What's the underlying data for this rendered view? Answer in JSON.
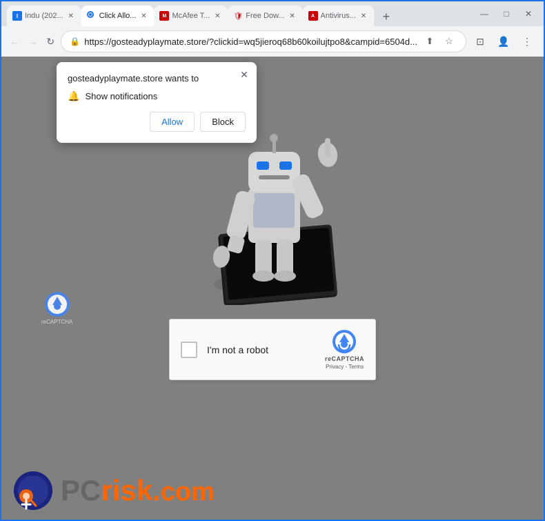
{
  "browser": {
    "tabs": [
      {
        "id": "tab1",
        "title": "Indu (202...",
        "active": false,
        "favicon": "indu"
      },
      {
        "id": "tab2",
        "title": "Click Allo...",
        "active": true,
        "favicon": "click"
      },
      {
        "id": "tab3",
        "title": "McAfee T...",
        "active": false,
        "favicon": "mcafee"
      },
      {
        "id": "tab4",
        "title": "Free Dow...",
        "active": false,
        "favicon": "shield"
      },
      {
        "id": "tab5",
        "title": "Antivirus...",
        "active": false,
        "favicon": "antivirus"
      }
    ],
    "new_tab_label": "+",
    "window_controls": {
      "minimize": "—",
      "maximize": "□",
      "close": "✕"
    },
    "nav": {
      "back": "←",
      "forward": "→",
      "reload": "↻",
      "url": "https://gosteadyplaymate.store/?clickid=wq5jieroq68b60koilujtpo8&campid=6504d...",
      "share_icon": "⬆",
      "bookmark_icon": "☆",
      "extensions_icon": "⊡",
      "profile_icon": "👤",
      "menu_icon": "⋮"
    }
  },
  "notification_popup": {
    "title": "gosteadyplaymate.store wants to",
    "notification_row": "Show notifications",
    "allow_label": "Allow",
    "block_label": "Block",
    "close_icon": "✕"
  },
  "recaptcha": {
    "checkbox_label": "I'm not a robot",
    "brand": "reCAPTCHA",
    "links": "Privacy - Terms"
  },
  "watermark": {
    "pc_text": "PC",
    "risk_text": "risk",
    "dot": ".",
    "com": "com"
  },
  "mini_recaptcha": {
    "label": "reCAPTCHA"
  }
}
